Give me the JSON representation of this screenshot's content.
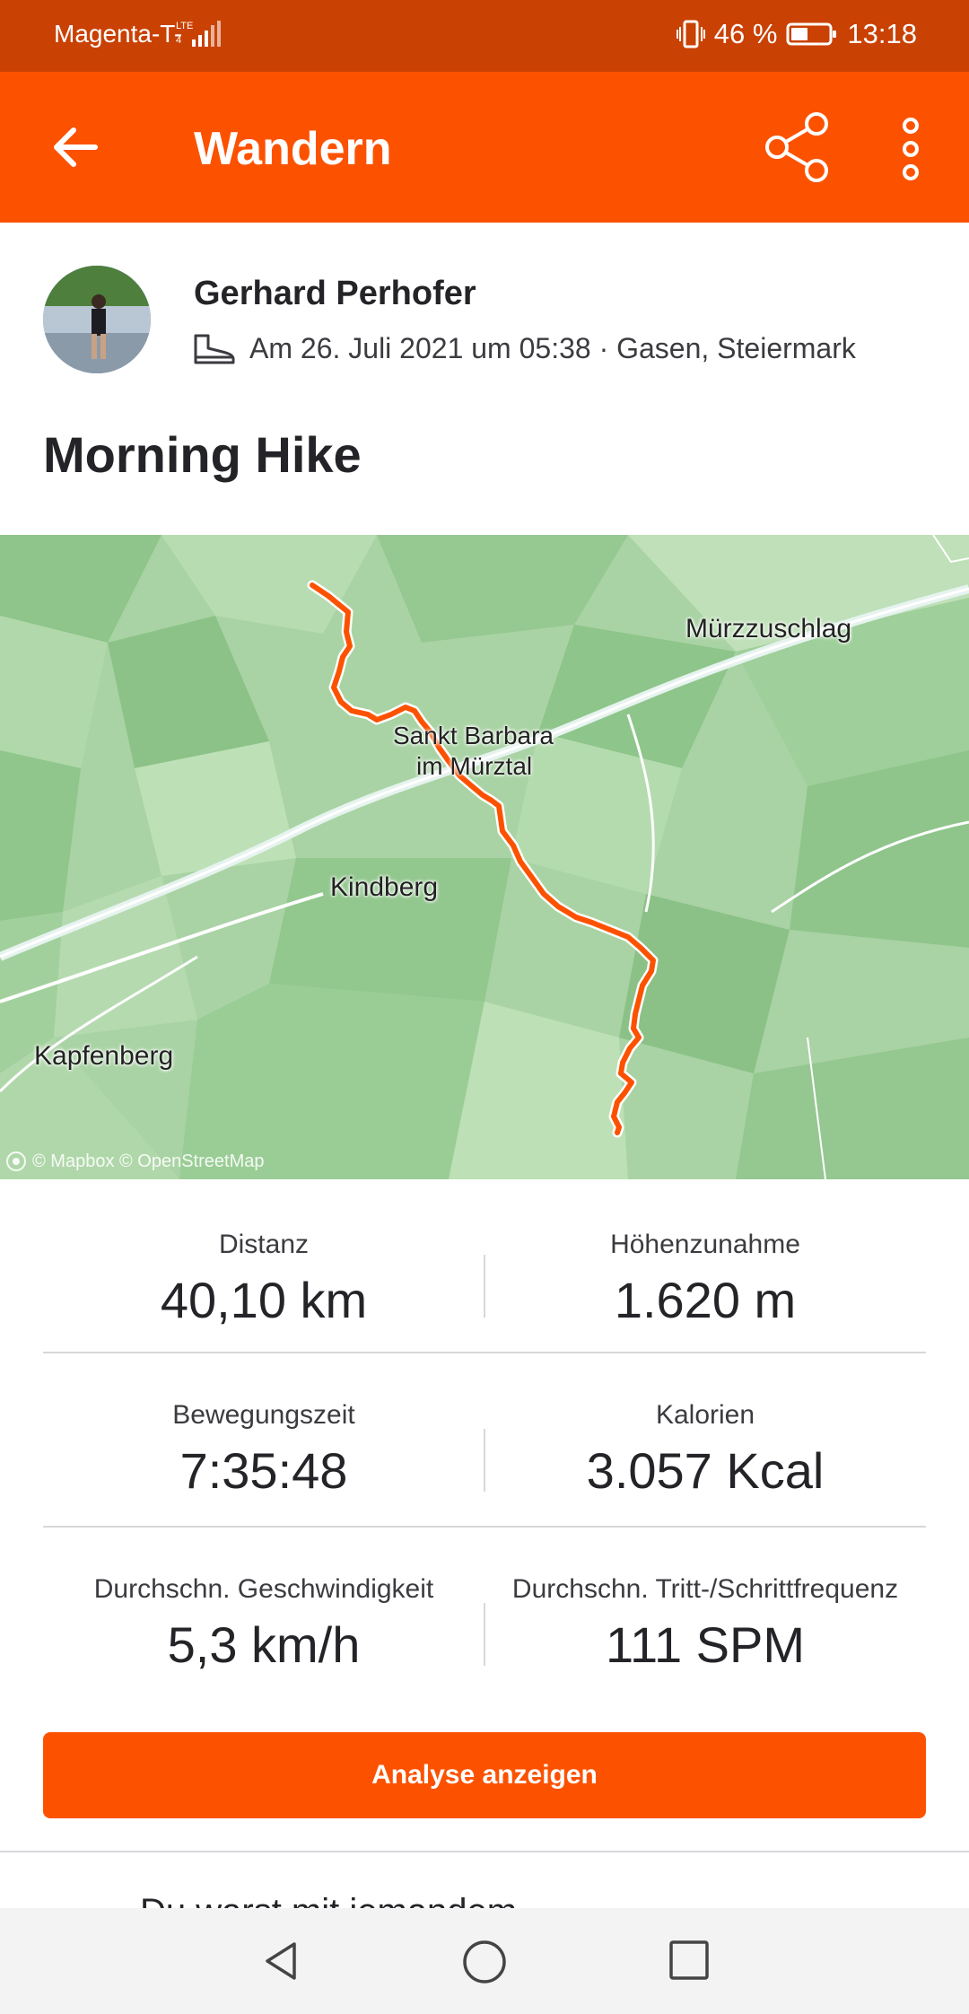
{
  "status_bar": {
    "carrier": "Magenta-T-",
    "network": "LTE",
    "battery_percent": "46 %",
    "time": "13:18"
  },
  "app_bar": {
    "title": "Wandern",
    "icons": [
      "arrow-left-icon",
      "share-icon",
      "more-vertical-icon"
    ]
  },
  "athlete": {
    "name": "Gerhard Perhofer",
    "activity_icon": "hiking-boot-icon",
    "meta": "Am 26. Juli 2021 um 05:38 · Gasen, Steiermark"
  },
  "activity": {
    "title": "Morning Hike"
  },
  "map": {
    "labels": {
      "muerzzuschlag": "Mürzzuschlag",
      "sankt_barbara_1": "Sankt Barbara",
      "sankt_barbara_2": "im Mürztal",
      "kindberg": "Kindberg",
      "kapfenberg": "Kapfenberg"
    },
    "attribution": "© Mapbox © OpenStreetMap",
    "route_color": "#fc5200"
  },
  "stats": [
    {
      "left": {
        "label": "Distanz",
        "value": "40,10 km"
      },
      "right": {
        "label": "Höhenzunahme",
        "value": "1.620 m"
      }
    },
    {
      "left": {
        "label": "Bewegungszeit",
        "value": "7:35:48"
      },
      "right": {
        "label": "Kalorien",
        "value": "3.057 Kcal"
      }
    },
    {
      "left": {
        "label": "Durchschn. Geschwindigkeit",
        "value": "5,3 km/h"
      },
      "right": {
        "label": "Durchschn. Tritt-/Schrittfrequenz",
        "value": "111 SPM"
      }
    }
  ],
  "actions": {
    "analyse": "Analyse anzeigen"
  },
  "teaser": "Du warst mit jemandem",
  "colors": {
    "brand": "#fc5200",
    "status_bar": "#c94103"
  }
}
